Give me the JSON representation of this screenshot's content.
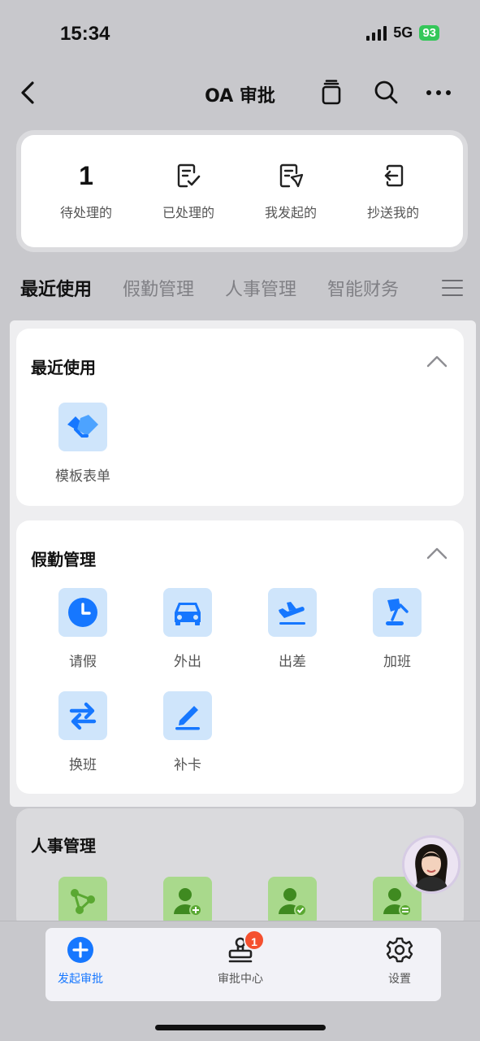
{
  "status_bar": {
    "time": "15:34",
    "network": "5G",
    "battery": "93"
  },
  "nav": {
    "title": "OA 审批",
    "icons": [
      "back-icon",
      "stack-icon",
      "search-icon",
      "more-icon"
    ]
  },
  "stats": [
    {
      "label": "待处理的",
      "value": "1",
      "icon": "count"
    },
    {
      "label": "已处理的",
      "icon": "doc-check-icon"
    },
    {
      "label": "我发起的",
      "icon": "doc-send-icon"
    },
    {
      "label": "抄送我的",
      "icon": "cc-icon"
    }
  ],
  "category_tabs": [
    "最近使用",
    "假勤管理",
    "人事管理",
    "智能财务"
  ],
  "sections": {
    "recent": {
      "title": "最近使用",
      "items": [
        {
          "label": "模板表单",
          "icon": "handshake-icon"
        }
      ]
    },
    "attendance": {
      "title": "假勤管理",
      "items": [
        {
          "label": "请假",
          "icon": "clock-icon"
        },
        {
          "label": "外出",
          "icon": "car-icon"
        },
        {
          "label": "出差",
          "icon": "plane-icon"
        },
        {
          "label": "加班",
          "icon": "lamp-icon"
        },
        {
          "label": "换班",
          "icon": "swap-icon"
        },
        {
          "label": "补卡",
          "icon": "pen-icon"
        }
      ]
    },
    "hr": {
      "title": "人事管理",
      "icons": [
        "branch-icon",
        "user-add-icon",
        "user-check-icon",
        "user-transfer-icon"
      ]
    }
  },
  "bottom_nav": [
    {
      "label": "发起审批",
      "icon": "plus-circle-icon",
      "active": true
    },
    {
      "label": "审批中心",
      "icon": "stamp-icon",
      "badge": "1"
    },
    {
      "label": "设置",
      "icon": "settings-icon"
    }
  ],
  "colors": {
    "accent": "#1677ff",
    "tile_bg": "#cfe5fb",
    "badge": "#f5502f",
    "hr_tile": "#a9d98c"
  }
}
